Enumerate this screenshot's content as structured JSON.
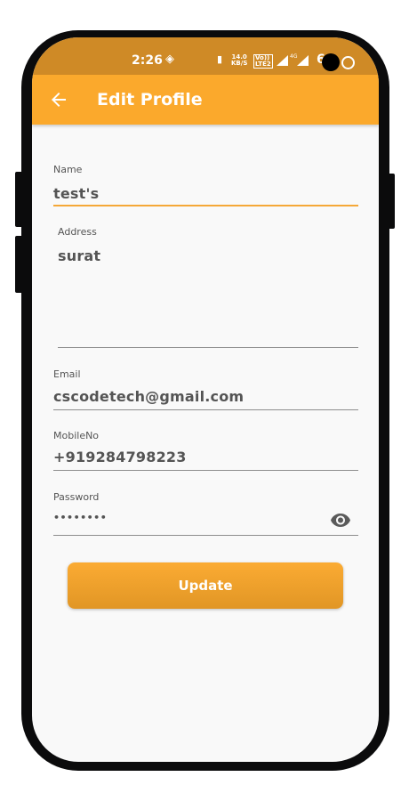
{
  "status_bar": {
    "time": "2:26",
    "speed_value": "14.0",
    "speed_unit": "KB/S",
    "volte_top": "Vo))",
    "volte_bottom": "LTE2",
    "network_tag": "4G",
    "battery": "6"
  },
  "app_bar": {
    "title": "Edit Profile"
  },
  "form": {
    "name": {
      "label": "Name",
      "value": "test's"
    },
    "address": {
      "label": "Address",
      "value": "surat"
    },
    "email": {
      "label": "Email",
      "value": "cscodetech@gmail.com"
    },
    "mobile": {
      "label": "MobileNo",
      "value": "+919284798223"
    },
    "password": {
      "label": "Password",
      "value": "••••••••"
    }
  },
  "update_button": {
    "label": "Update"
  },
  "colors": {
    "status_bar": "#cf8a26",
    "app_bar": "#fba92c",
    "accent": "#f5a838",
    "background": "#f9f9f9"
  }
}
